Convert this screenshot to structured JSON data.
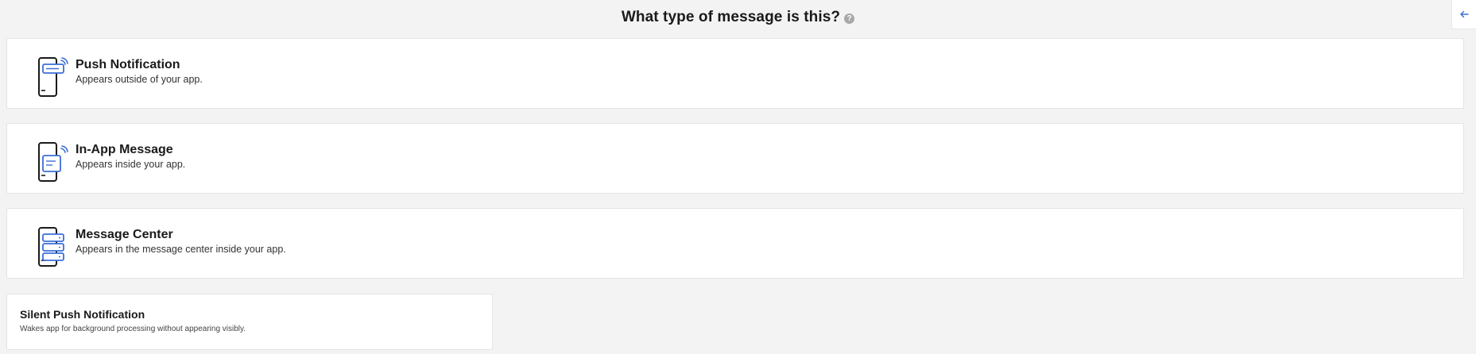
{
  "header": {
    "title": "What type of message is this?",
    "help_glyph": "?"
  },
  "back_button": {
    "icon": "arrow-left-icon"
  },
  "colors": {
    "accent": "#3b6fd8",
    "background": "#f3f3f3",
    "card": "#ffffff"
  },
  "options": [
    {
      "title": "Push Notification",
      "description": "Appears outside of your app.",
      "icon": "push-notification-icon"
    },
    {
      "title": "In-App Message",
      "description": "Appears inside your app.",
      "icon": "in-app-message-icon"
    },
    {
      "title": "Message Center",
      "description": "Appears in the message center inside your app.",
      "icon": "message-center-icon"
    },
    {
      "title": "Silent Push Notification",
      "description": "Wakes app for background processing without appearing visibly."
    }
  ]
}
